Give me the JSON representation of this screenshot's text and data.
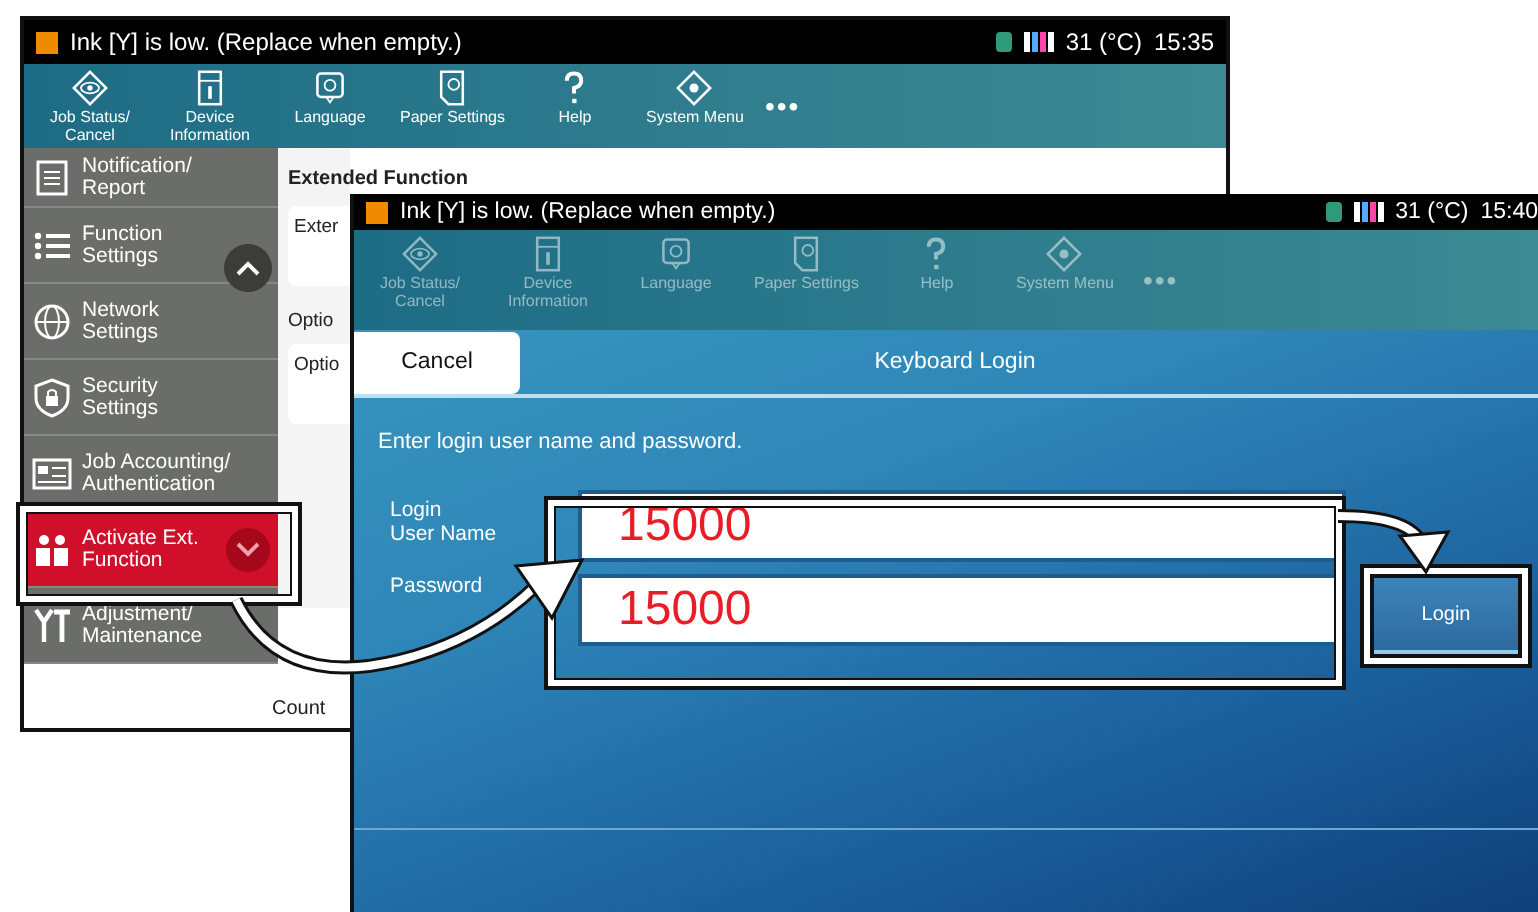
{
  "back_screen": {
    "status_bar": {
      "message": "Ink [Y] is low. (Replace when empty.)",
      "temperature": "31 (°C)",
      "time": "15:35"
    },
    "toolbar": [
      {
        "label": "Job Status/\nCancel"
      },
      {
        "label": "Device\nInformation"
      },
      {
        "label": "Language"
      },
      {
        "label": "Paper Settings"
      },
      {
        "label": "Help"
      },
      {
        "label": "System Menu"
      }
    ],
    "more": "•••",
    "sidebar": {
      "items": [
        {
          "label": "Notification/\nReport",
          "selected": false
        },
        {
          "label": "Function\nSettings",
          "selected": false
        },
        {
          "label": "Network\nSettings",
          "selected": false
        },
        {
          "label": "Security\nSettings",
          "selected": false
        },
        {
          "label": "Job Accounting/\nAuthentication",
          "selected": false
        },
        {
          "label": "Activate Ext.\nFunction",
          "selected": true
        },
        {
          "label": "Adjustment/\nMaintenance",
          "selected": false
        }
      ]
    },
    "content": {
      "heading": "Extended Function",
      "sections": [
        {
          "kind": "card",
          "text": "Exter"
        },
        {
          "kind": "heading",
          "text": "Optio"
        },
        {
          "kind": "card",
          "text": "Optio"
        }
      ],
      "footer": "Count"
    }
  },
  "front_screen": {
    "status_bar": {
      "message": "Ink [Y] is low. (Replace when empty.)",
      "temperature": "31 (°C)",
      "time": "15:40"
    },
    "toolbar": [
      {
        "label": "Job Status/\nCancel"
      },
      {
        "label": "Device\nInformation"
      },
      {
        "label": "Language"
      },
      {
        "label": "Paper Settings"
      },
      {
        "label": "Help"
      },
      {
        "label": "System Menu"
      }
    ],
    "more": "•••",
    "cancel_button": "Cancel",
    "title": "Keyboard Login",
    "instruction": "Enter login user name and password.",
    "fields": [
      {
        "label": "Login\nUser Name",
        "value": "15000"
      },
      {
        "label": "Password",
        "value": "15000"
      }
    ],
    "login_button": "Login"
  }
}
